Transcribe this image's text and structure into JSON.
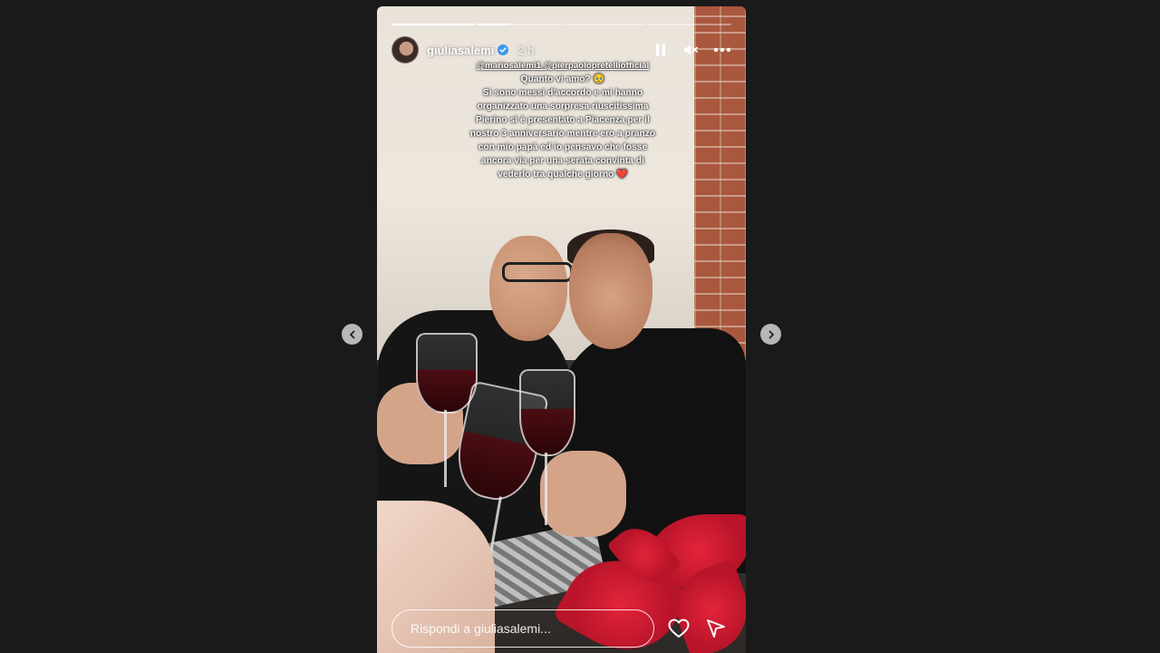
{
  "story": {
    "username": "giuliasalemi",
    "verified": true,
    "time": "2 h",
    "progress": [
      1,
      0.4,
      0,
      0
    ],
    "mentions": "@mariosalemi1 @pierpaolopretelliofficial",
    "caption_lines": [
      "Quanto vi amo? 🥹",
      "Si sono messi d'accordo e mi hanno",
      "organizzato una sorpresa riuscitissima",
      "Pierino si è presentato a Piacenza per il",
      "nostro 3 anniversario mentre ero a pranzo",
      "con mio papà ed io pensavo che fosse",
      "ancora via per una serata convinta di",
      "vederlo tra qualche giorno ❤️"
    ]
  },
  "footer": {
    "reply_placeholder": "Rispondi a giuliasalemi..."
  },
  "icons": {
    "pause": "pause-icon",
    "mute": "muted-speaker-icon",
    "more": "more-options-icon",
    "like": "heart-icon",
    "share": "send-icon",
    "prev": "chevron-left-icon",
    "next": "chevron-right-icon"
  },
  "colors": {
    "background": "#1a1a1a",
    "nav_button": "#b7b7b7",
    "verified": "#3897f0"
  }
}
